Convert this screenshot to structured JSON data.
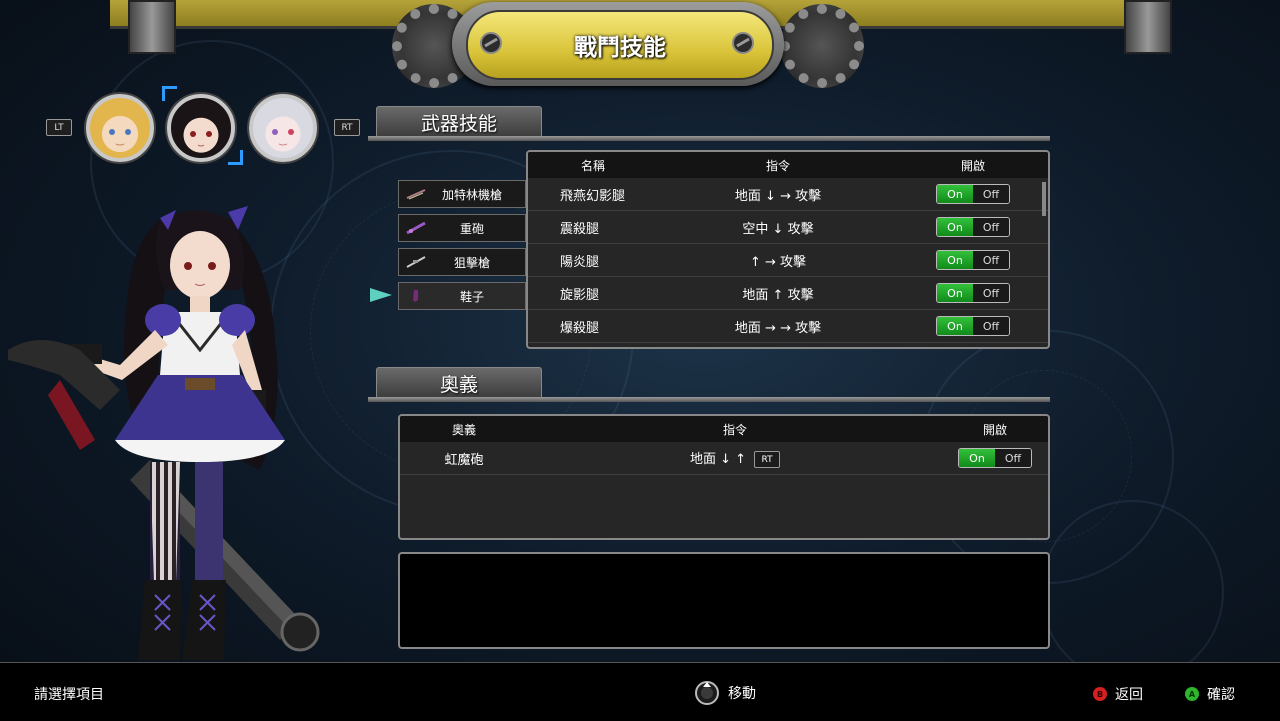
{
  "screen_title": "戰鬥技能",
  "character_switch": {
    "left_button": "LT",
    "right_button": "RT"
  },
  "sections": {
    "weapon_skills": "武器技能",
    "ultimate": "奧義"
  },
  "weapons": [
    {
      "label": "加特林機槍",
      "icon": "gatling-gun-icon"
    },
    {
      "label": "重砲",
      "icon": "heavy-cannon-icon"
    },
    {
      "label": "狙擊槍",
      "icon": "sniper-rifle-icon"
    },
    {
      "label": "鞋子",
      "icon": "shoes-icon",
      "selected": true
    }
  ],
  "skill_table": {
    "headers": {
      "name": "名稱",
      "command": "指令",
      "enable": "開啟"
    },
    "rows": [
      {
        "name": "飛燕幻影腿",
        "command": "地面 ↓ → 攻擊",
        "on": "On",
        "off": "Off"
      },
      {
        "name": "震殺腿",
        "command": "空中 ↓ 攻擊",
        "on": "On",
        "off": "Off"
      },
      {
        "name": "陽炎腿",
        "command": "↑ → 攻擊",
        "on": "On",
        "off": "Off"
      },
      {
        "name": "旋影腿",
        "command": "地面 ↑ 攻擊",
        "on": "On",
        "off": "Off"
      },
      {
        "name": "爆殺腿",
        "command": "地面 → → 攻擊",
        "on": "On",
        "off": "Off"
      }
    ]
  },
  "ultimate_table": {
    "headers": {
      "name": "奧義",
      "command": "指令",
      "enable": "開啟"
    },
    "rows": [
      {
        "name": "虹魔砲",
        "command": "地面 ↓ ↑",
        "key": "RT",
        "on": "On",
        "off": "Off"
      }
    ]
  },
  "bottom_bar": {
    "prompt": "請選擇項目",
    "move_label": "移動",
    "back_button": "B",
    "back_label": "返回",
    "confirm_button": "A",
    "confirm_label": "確認"
  },
  "colors": {
    "toggle_on": "#1fa62a",
    "selection_highlight": "#2e9bff",
    "title_plate": "#d9c43a",
    "button_b": "#d42020",
    "button_a": "#2db52d"
  }
}
